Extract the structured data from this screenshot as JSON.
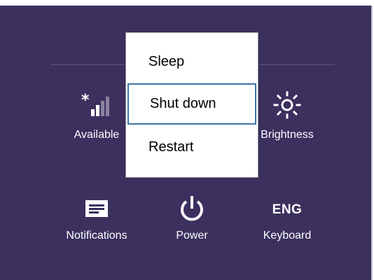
{
  "settings_tiles": {
    "network": {
      "label": "Available",
      "icon": "wifi-signal-icon"
    },
    "brightness": {
      "label": "Brightness",
      "icon": "sun-icon"
    },
    "notifications": {
      "label": "Notifications",
      "icon": "message-icon"
    },
    "power": {
      "label": "Power",
      "icon": "power-icon"
    },
    "keyboard": {
      "label": "Keyboard",
      "code": "ENG"
    }
  },
  "power_menu": {
    "items": [
      {
        "label": "Sleep",
        "selected": false
      },
      {
        "label": "Shut down",
        "selected": true
      },
      {
        "label": "Restart",
        "selected": false
      }
    ]
  },
  "colors": {
    "panel_bg": "#3b305e",
    "menu_bg": "#ffffff",
    "focus_border": "#3c76a8",
    "text_light": "#ffffff"
  }
}
